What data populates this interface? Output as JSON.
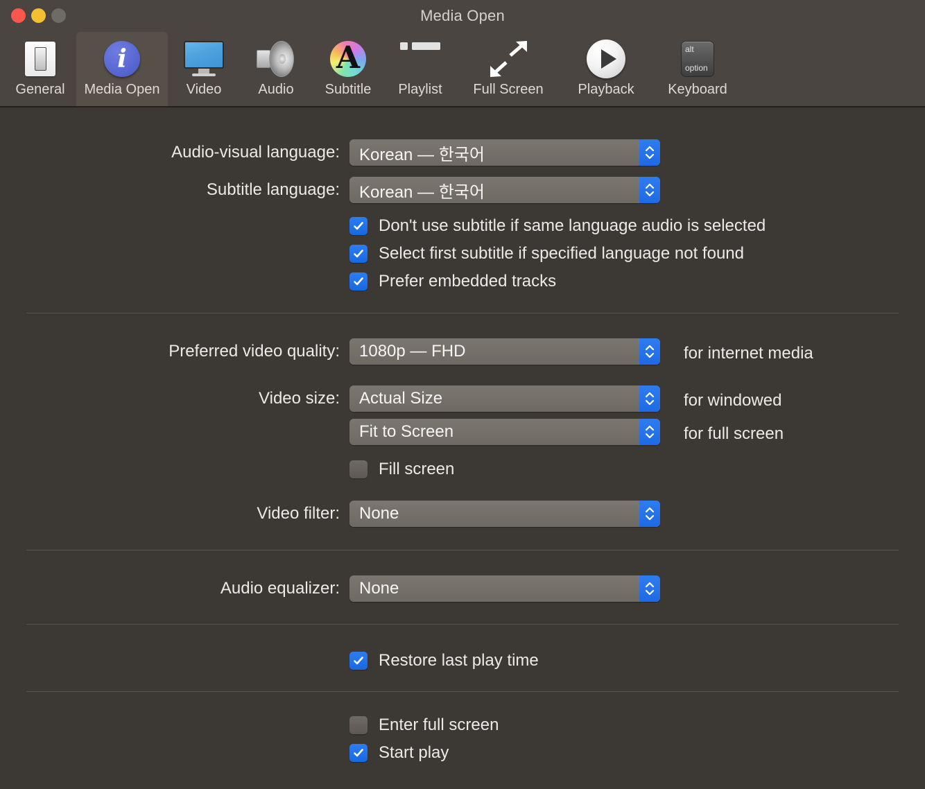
{
  "window": {
    "title": "Media Open",
    "traffic_lights": [
      "close-button",
      "minimize-button",
      "zoom-button"
    ]
  },
  "toolbar": {
    "selected": "Media Open",
    "tabs": [
      {
        "label": "General",
        "icon": "light-switch-icon"
      },
      {
        "label": "Media Open",
        "icon": "info-circle-icon"
      },
      {
        "label": "Video",
        "icon": "monitor-icon"
      },
      {
        "label": "Audio",
        "icon": "speaker-icon"
      },
      {
        "label": "Subtitle",
        "icon": "letter-a-color-wheel-icon"
      },
      {
        "label": "Playlist",
        "icon": "list-icon"
      },
      {
        "label": "Full Screen",
        "icon": "diagonal-arrows-icon"
      },
      {
        "label": "Playback",
        "icon": "play-circle-icon"
      },
      {
        "label": "Keyboard",
        "icon": "option-key-icon"
      }
    ],
    "keyboard_icon_text": {
      "top": "alt",
      "bottom": "option"
    }
  },
  "main": {
    "language_section": {
      "audio_visual_language": {
        "label": "Audio-visual language:",
        "value": "Korean — 한국어"
      },
      "subtitle_language": {
        "label": "Subtitle language:",
        "value": "Korean — 한국어"
      },
      "checkboxes": [
        {
          "label": "Don't use subtitle if same language audio is selected",
          "checked": true
        },
        {
          "label": "Select first subtitle if specified language not found",
          "checked": true
        },
        {
          "label": "Prefer embedded tracks",
          "checked": true
        }
      ]
    },
    "video_section": {
      "preferred_video_quality": {
        "label": "Preferred video quality:",
        "value": "1080p — FHD",
        "suffix": "for internet media"
      },
      "video_size": {
        "label": "Video size:",
        "windowed_value": "Actual Size",
        "windowed_suffix": "for windowed",
        "fullscreen_value": "Fit to Screen",
        "fullscreen_suffix": "for full screen"
      },
      "fill_screen": {
        "label": "Fill screen",
        "checked": false
      },
      "video_filter": {
        "label": "Video filter:",
        "value": "None"
      }
    },
    "audio_section": {
      "audio_equalizer": {
        "label": "Audio equalizer:",
        "value": "None"
      }
    },
    "restore_section": {
      "restore_last_play_time": {
        "label": "Restore last play time",
        "checked": true
      }
    },
    "startup_section": {
      "enter_full_screen": {
        "label": "Enter full screen",
        "checked": false
      },
      "start_play": {
        "label": "Start play",
        "checked": true
      }
    }
  },
  "colors": {
    "window_background": "#3c3834",
    "titlebar_background": "#4a4540",
    "accent_blue": "#2f7cf0",
    "popup_background": "#7b7670",
    "text": "#eceae8",
    "close_light": "#f9564c",
    "minimize_light": "#f2c030",
    "zoom_light": "#6e6a66"
  }
}
